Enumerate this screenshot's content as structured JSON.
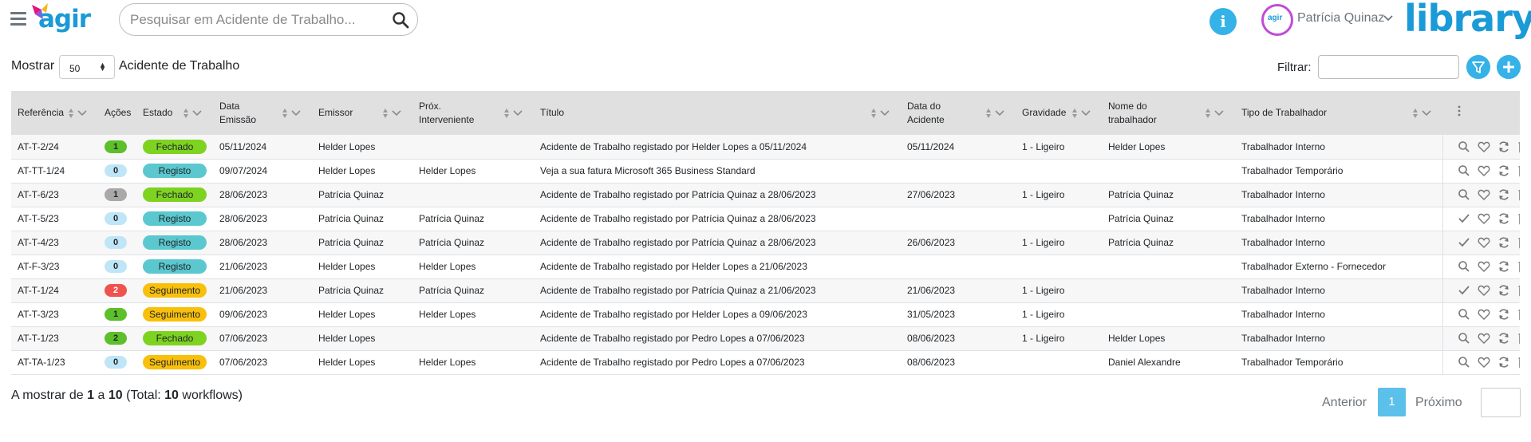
{
  "header": {
    "logo_text": "agir",
    "search_placeholder": "Pesquisar em Acidente de Trabalho...",
    "user_name": "Patrícia Quinaz",
    "library_text": "library",
    "info_icon": "info-icon",
    "accent_color": "#35b2e8"
  },
  "controls": {
    "show_label": "Mostrar",
    "page_size": "50",
    "entity_label": "Acidente de Trabalho",
    "filter_label": "Filtrar:",
    "filter_value": ""
  },
  "table": {
    "columns": [
      {
        "label": "Referência"
      },
      {
        "label": "Ações"
      },
      {
        "label": "Estado"
      },
      {
        "label": "Data Emissão"
      },
      {
        "label": "Emissor"
      },
      {
        "label": "Próx. Interveniente"
      },
      {
        "label": "Título"
      },
      {
        "label": "Data do Acidente"
      },
      {
        "label": "Gravidade"
      },
      {
        "label": "Nome do trabalhador"
      },
      {
        "label": "Tipo de Trabalhador"
      }
    ],
    "rows": [
      {
        "ref": "AT-T-2/24",
        "acoes": "1",
        "acoes_color": "#5cc02a",
        "acoes_text": "#212529",
        "estado": "Fechado",
        "estado_color": "#7ed321",
        "emissao": "05/11/2024",
        "emissor": "Helder Lopes",
        "prox": "",
        "titulo": "Acidente de Trabalho registado por Helder Lopes a 05/11/2024",
        "data_acid": "05/11/2024",
        "gravidade": "1 - Ligeiro",
        "nome": "Helder Lopes",
        "tipo": "Trabalhador Interno",
        "first_action": "search"
      },
      {
        "ref": "AT-TT-1/24",
        "acoes": "0",
        "acoes_color": "#bfe6f7",
        "acoes_text": "#212529",
        "estado": "Registo",
        "estado_color": "#5bc8cf",
        "emissao": "09/07/2024",
        "emissor": "Helder Lopes",
        "prox": "Helder Lopes",
        "titulo": "Veja a sua fatura Microsoft 365 Business Standard",
        "data_acid": "",
        "gravidade": "",
        "nome": "",
        "tipo": "Trabalhador Temporário",
        "first_action": "search"
      },
      {
        "ref": "AT-T-6/23",
        "acoes": "1",
        "acoes_color": "#a9a9a9",
        "acoes_text": "#212529",
        "estado": "Fechado",
        "estado_color": "#7ed321",
        "emissao": "28/06/2023",
        "emissor": "Patrícia Quinaz",
        "prox": "",
        "titulo": "Acidente de Trabalho registado por Patrícia Quinaz a 28/06/2023",
        "data_acid": "27/06/2023",
        "gravidade": "1 - Ligeiro",
        "nome": "Patrícia Quinaz",
        "tipo": "Trabalhador Interno",
        "first_action": "search"
      },
      {
        "ref": "AT-T-5/23",
        "acoes": "0",
        "acoes_color": "#bfe6f7",
        "acoes_text": "#212529",
        "estado": "Registo",
        "estado_color": "#5bc8cf",
        "emissao": "28/06/2023",
        "emissor": "Patrícia Quinaz",
        "prox": "Patrícia Quinaz",
        "titulo": "Acidente de Trabalho registado por Patrícia Quinaz a 28/06/2023",
        "data_acid": "",
        "gravidade": "",
        "nome": "Patrícia Quinaz",
        "tipo": "Trabalhador Interno",
        "first_action": "check"
      },
      {
        "ref": "AT-T-4/23",
        "acoes": "0",
        "acoes_color": "#bfe6f7",
        "acoes_text": "#212529",
        "estado": "Registo",
        "estado_color": "#5bc8cf",
        "emissao": "28/06/2023",
        "emissor": "Patrícia Quinaz",
        "prox": "Patrícia Quinaz",
        "titulo": "Acidente de Trabalho registado por Patrícia Quinaz a 28/06/2023",
        "data_acid": "26/06/2023",
        "gravidade": "1 - Ligeiro",
        "nome": "Patrícia Quinaz",
        "tipo": "Trabalhador Interno",
        "first_action": "check"
      },
      {
        "ref": "AT-F-3/23",
        "acoes": "0",
        "acoes_color": "#bfe6f7",
        "acoes_text": "#212529",
        "estado": "Registo",
        "estado_color": "#5bc8cf",
        "emissao": "21/06/2023",
        "emissor": "Helder Lopes",
        "prox": "Helder Lopes",
        "titulo": "Acidente de Trabalho registado por Helder Lopes a 21/06/2023",
        "data_acid": "",
        "gravidade": "",
        "nome": "",
        "tipo": "Trabalhador Externo - Fornecedor",
        "first_action": "search"
      },
      {
        "ref": "AT-T-1/24",
        "acoes": "2",
        "acoes_color": "#f0524f",
        "acoes_text": "#ffffff",
        "estado": "Seguimento",
        "estado_color": "#f9c00b",
        "emissao": "21/06/2023",
        "emissor": "Patrícia Quinaz",
        "prox": "Patrícia Quinaz",
        "titulo": "Acidente de Trabalho registado por Patrícia Quinaz a 21/06/2023",
        "data_acid": "21/06/2023",
        "gravidade": "1 - Ligeiro",
        "nome": "",
        "tipo": "Trabalhador Interno",
        "first_action": "check"
      },
      {
        "ref": "AT-T-3/23",
        "acoes": "1",
        "acoes_color": "#5cc02a",
        "acoes_text": "#212529",
        "estado": "Seguimento",
        "estado_color": "#f9c00b",
        "emissao": "09/06/2023",
        "emissor": "Helder Lopes",
        "prox": "Helder Lopes",
        "titulo": "Acidente de Trabalho registado por Helder Lopes a 09/06/2023",
        "data_acid": "31/05/2023",
        "gravidade": "1 - Ligeiro",
        "nome": "",
        "tipo": "Trabalhador Interno",
        "first_action": "search"
      },
      {
        "ref": "AT-T-1/23",
        "acoes": "2",
        "acoes_color": "#5cc02a",
        "acoes_text": "#212529",
        "estado": "Fechado",
        "estado_color": "#7ed321",
        "emissao": "07/06/2023",
        "emissor": "Helder Lopes",
        "prox": "",
        "titulo": "Acidente de Trabalho registado por Pedro Lopes a 07/06/2023",
        "data_acid": "08/06/2023",
        "gravidade": "1 - Ligeiro",
        "nome": "Helder Lopes",
        "tipo": "Trabalhador Interno",
        "first_action": "search"
      },
      {
        "ref": "AT-TA-1/23",
        "acoes": "0",
        "acoes_color": "#bfe6f7",
        "acoes_text": "#212529",
        "estado": "Seguimento",
        "estado_color": "#f9c00b",
        "emissao": "07/06/2023",
        "emissor": "Helder Lopes",
        "prox": "Helder Lopes",
        "titulo": "Acidente de Trabalho registado por Pedro Lopes a 07/06/2023",
        "data_acid": "08/06/2023",
        "gravidade": "",
        "nome": "Daniel Alexandre",
        "tipo": "Trabalhador Temporário",
        "first_action": "search"
      }
    ]
  },
  "footer": {
    "info_prefix": "A mostrar de",
    "from": "1",
    "info_mid": "a",
    "to": "10",
    "total_prefix": "(Total:",
    "total": "10",
    "total_suffix": "workflows)",
    "prev_label": "Anterior",
    "current_page": "1",
    "next_label": "Próximo"
  }
}
